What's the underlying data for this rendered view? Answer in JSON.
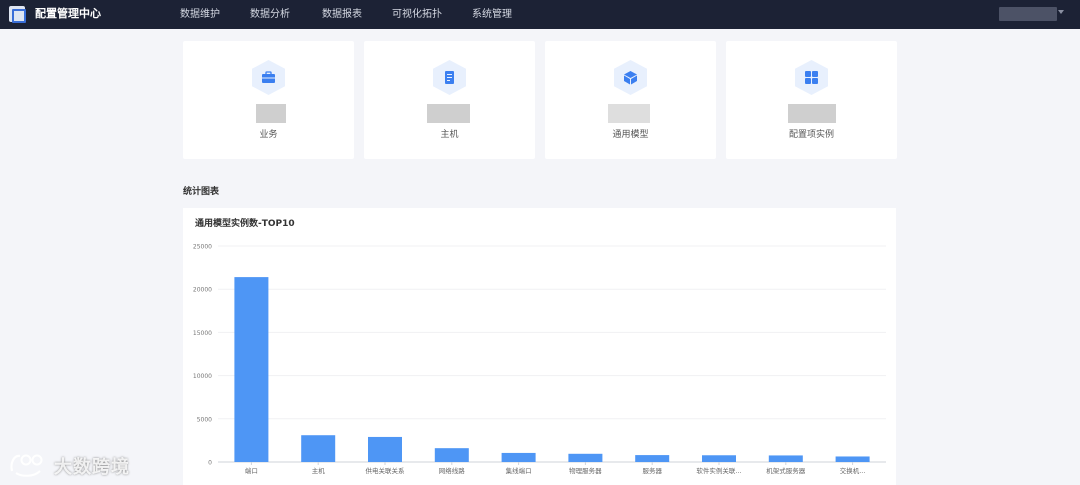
{
  "app": {
    "title": "配置管理中心"
  },
  "nav": {
    "items": [
      {
        "label": "数据维护"
      },
      {
        "label": "数据分析"
      },
      {
        "label": "数据报表"
      },
      {
        "label": "可视化拓扑"
      },
      {
        "label": "系统管理"
      }
    ]
  },
  "cards": [
    {
      "label": "业务",
      "icon": "briefcase-icon"
    },
    {
      "label": "主机",
      "icon": "document-icon"
    },
    {
      "label": "通用模型",
      "icon": "cube-icon"
    },
    {
      "label": "配置项实例",
      "icon": "grid-icon"
    }
  ],
  "section": {
    "title": "统计图表"
  },
  "colors": {
    "topbar": "#1c2235",
    "accent": "#4e96f5",
    "icon_bg": "#e8f0fd"
  },
  "watermark": {
    "text": "大数跨境"
  },
  "chart_data": {
    "type": "bar",
    "title": "通用模型实例数-TOP10",
    "categories": [
      "端口",
      "主机",
      "供电关联关系",
      "网络线路",
      "集线端口",
      "物理服务器",
      "服务器",
      "软件实例关联...",
      "机架式服务器",
      "交换机..."
    ],
    "values": [
      21400,
      3100,
      2900,
      1600,
      1050,
      950,
      800,
      780,
      760,
      640
    ],
    "yticks": [
      "25000",
      "20000",
      "15000",
      "10000",
      "5000",
      "0"
    ],
    "ylim": [
      0,
      25000
    ],
    "xlabel": "",
    "ylabel": "",
    "grid": true,
    "bar_color": "#4e96f5"
  }
}
